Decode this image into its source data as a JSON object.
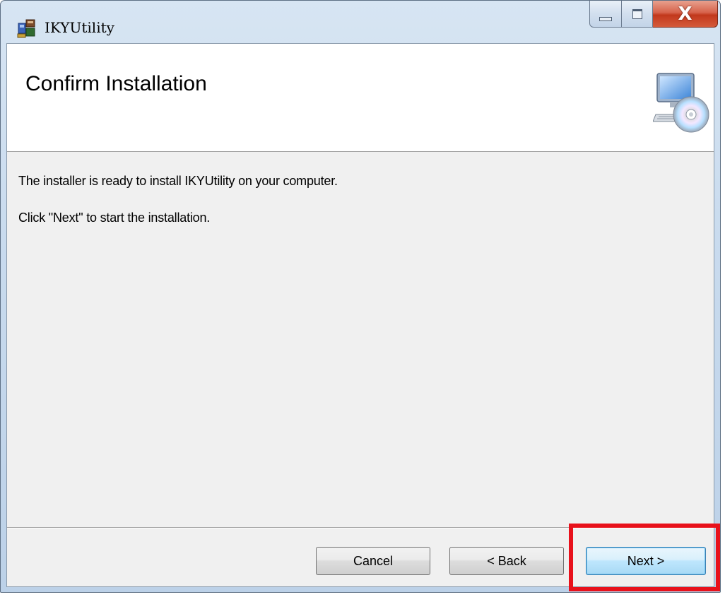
{
  "window": {
    "title": "IKYUtility",
    "icon": "installer-icon",
    "caption_buttons": {
      "minimize_icon": "minimize-icon",
      "maximize_icon": "maximize-icon",
      "close_label": "X"
    }
  },
  "header": {
    "title": "Confirm Installation",
    "icon": "computer-cd-icon"
  },
  "body": {
    "line1": "The installer is ready to install IKYUtility on your computer.",
    "line2": "Click \"Next\" to start the installation."
  },
  "buttons": {
    "cancel_label": "Cancel",
    "back_label": "< Back",
    "next_label": "Next >"
  },
  "colors": {
    "highlight": "#e8111b",
    "client_background": "#f0f0f0",
    "header_background": "#ffffff",
    "default_button_border": "#3c7fb1"
  }
}
